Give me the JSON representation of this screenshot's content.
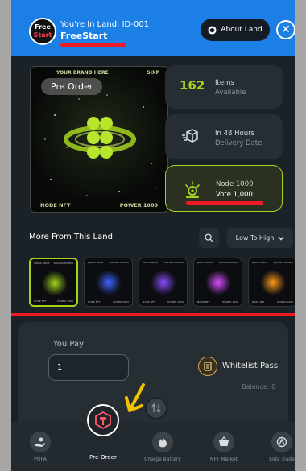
{
  "header": {
    "badge_line1": "Free",
    "badge_line2": "Start",
    "land_line": "You're In Land: ID-001",
    "land_name": "FreeStart",
    "about_label": "About Land"
  },
  "nft": {
    "top_left": "YOUR BRAND HERE",
    "top_right": "SIXP",
    "preorder_chip": "Pre Order",
    "bottom_left": "NODE NFT",
    "bottom_right": "POWER 1000"
  },
  "stats": {
    "items_count": "162",
    "items_label1": "Items",
    "items_label2": "Available",
    "delivery_label1": "In 48 Hours",
    "delivery_label2": "Delivery Date",
    "node_label": "Node 1000",
    "vote_label": "Vote 1,000"
  },
  "more": {
    "title": "More From This Land",
    "sort_label": "Low To High"
  },
  "thumbnails": [
    {
      "color": "#a4d41e",
      "top_left": "JARVIS NODE",
      "top_right": "DAVINCI POWER",
      "bottom_left": "NODE NFT",
      "bottom_right": "POWER 1000"
    },
    {
      "color": "#3e62ff",
      "top_left": "JARVIS NODE",
      "top_right": "DAVINCI POWER",
      "bottom_left": "NODE NFT",
      "bottom_right": "POWER 1000"
    },
    {
      "color": "#8a4dff",
      "top_left": "JARVIS NODE",
      "top_right": "DAVINCI POWER",
      "bottom_left": "NODE NFT",
      "bottom_right": "POWER 1000"
    },
    {
      "color": "#d84cff",
      "top_left": "JARVIS NODE",
      "top_right": "DAVINCI POWER",
      "bottom_left": "NODE NFT",
      "bottom_right": "POWER 1000"
    },
    {
      "color": "#ff9a1a",
      "top_left": "JARVIS NODE",
      "top_right": "DAVINCI POWER",
      "bottom_left": "NODE NFT",
      "bottom_right": "POWER 1000"
    }
  ],
  "pay": {
    "you_pay_label": "You Pay",
    "input_value": "1",
    "whitelist_label": "Whitelist Pass",
    "balance_label": "Balance: 0"
  },
  "nav": {
    "items": [
      {
        "label": "POPA",
        "icon": "hand-coin-icon"
      },
      {
        "label": "Pre-Order",
        "icon": "hammer-hexagon-icon"
      },
      {
        "label": "Charge Battery",
        "icon": "fire-icon"
      },
      {
        "label": "NFT Market",
        "icon": "basket-icon"
      },
      {
        "label": "Elite Trade",
        "icon": "trade-icon"
      }
    ]
  },
  "colors": {
    "accent_green": "#a4d41e",
    "header_blue": "#1b7fe6",
    "annotation_red": "#ee1a25",
    "annotation_yellow": "#f2c200"
  }
}
